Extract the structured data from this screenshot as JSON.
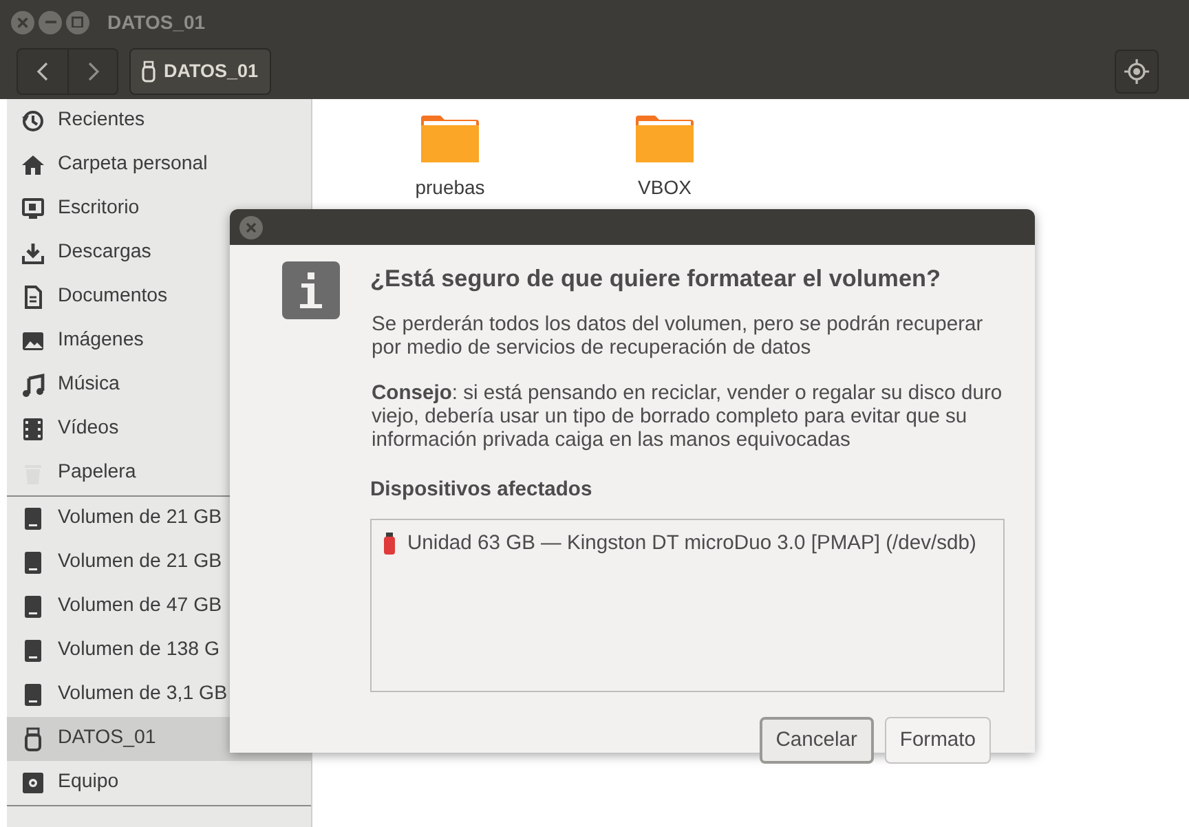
{
  "window": {
    "title": "DATOS_01"
  },
  "toolbar": {
    "location": "DATOS_01"
  },
  "sidebar": {
    "groups": [
      {
        "items": [
          {
            "label": "Recientes",
            "kind": "recent",
            "selected": false
          },
          {
            "label": "Carpeta personal",
            "kind": "home",
            "selected": false
          },
          {
            "label": "Escritorio",
            "kind": "desktop",
            "selected": false
          },
          {
            "label": "Descargas",
            "kind": "download",
            "selected": false
          },
          {
            "label": "Documentos",
            "kind": "document",
            "selected": false
          },
          {
            "label": "Imágenes",
            "kind": "image",
            "selected": false
          },
          {
            "label": "Música",
            "kind": "music",
            "selected": false
          },
          {
            "label": "Vídeos",
            "kind": "video",
            "selected": false
          },
          {
            "label": "Papelera",
            "kind": "trash",
            "selected": false
          }
        ]
      },
      {
        "items": [
          {
            "label": "Volumen de 21 GB",
            "kind": "drive",
            "selected": false
          },
          {
            "label": "Volumen de 21 GB",
            "kind": "drive",
            "selected": false
          },
          {
            "label": "Volumen de 47 GB",
            "kind": "drive",
            "selected": false
          },
          {
            "label": "Volumen de 138 G",
            "kind": "drive",
            "selected": false
          },
          {
            "label": "Volumen de 3,1 GB",
            "kind": "drive",
            "selected": false
          },
          {
            "label": "DATOS_01",
            "kind": "usb",
            "selected": true
          },
          {
            "label": "Equipo",
            "kind": "computer",
            "selected": false
          }
        ]
      }
    ]
  },
  "files": [
    {
      "name": "pruebas"
    },
    {
      "name": "VBOX"
    }
  ],
  "dialog": {
    "title": "¿Está seguro de que quiere formatear el volumen?",
    "message": "Se perderán todos los datos del volumen, pero se podrán recuperar por medio de servicios de recuperación de datos",
    "tip": "**Consejo**: si está pensando en reciclar, vender o regalar su disco duro viejo, debería usar un tipo de borrado completo para evitar que su información privada caiga en las manos equivocadas",
    "devices_heading": "Dispositivos afectados",
    "devices": [
      {
        "label": "Unidad 63 GB — Kingston DT microDuo 3.0 [PMAP] (/dev/sdb)"
      }
    ],
    "buttons": [
      {
        "label": "Cancelar",
        "focused": true
      },
      {
        "label": "Formato",
        "focused": false
      }
    ]
  }
}
